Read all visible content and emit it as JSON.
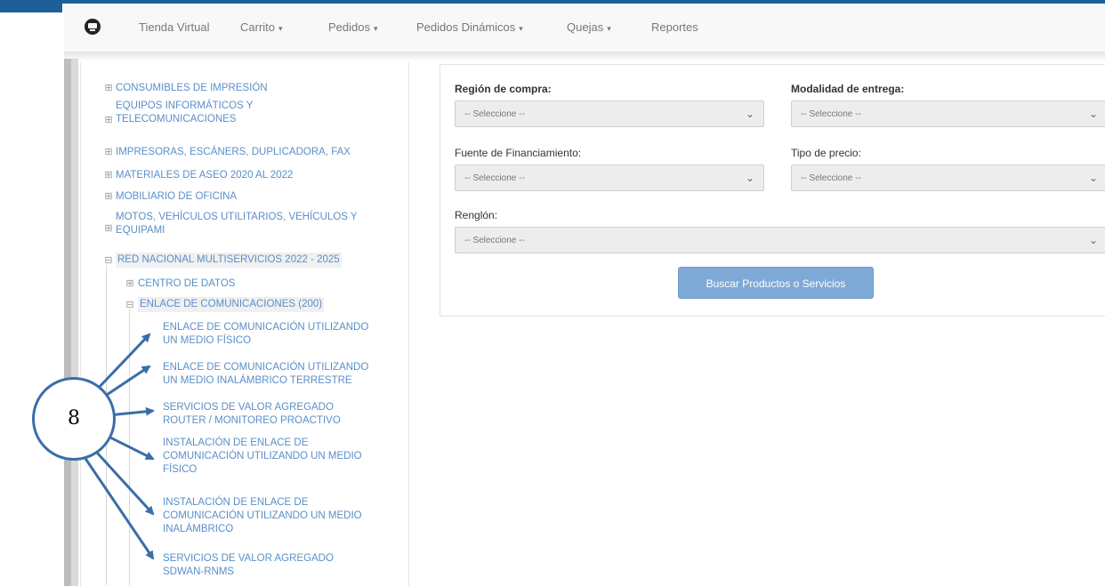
{
  "nav": {
    "items": [
      {
        "label": "Tienda Virtual",
        "caret": false
      },
      {
        "label": "Carrito",
        "caret": true
      },
      {
        "label": "Pedidos",
        "caret": true
      },
      {
        "label": "Pedidos Dinámicos",
        "caret": true
      },
      {
        "label": "Quejas",
        "caret": true
      },
      {
        "label": "Reportes",
        "caret": false
      }
    ],
    "caret_glyph": "▾"
  },
  "tree": {
    "items": [
      {
        "label": "CONSUMIBLES DE IMPRESIÓN"
      },
      {
        "label_lines": [
          "EQUIPOS INFORMÁTICOS Y",
          "TELECOMUNICACIONES"
        ]
      },
      {
        "label": "IMPRESORAS, ESCÁNERS, DUPLICADORA, FAX"
      },
      {
        "label": "MATERIALES DE ASEO 2020 AL 2022"
      },
      {
        "label": "MOBILIARIO DE OFICINA"
      },
      {
        "label_lines": [
          "MOTOS, VEHÍCULOS UTILITARIOS, VEHÍCULOS Y",
          "EQUIPAMI"
        ]
      },
      {
        "label": "RED NACIONAL MULTISERVICIOS 2022 - 2025"
      },
      {
        "label": "CENTRO DE DATOS"
      },
      {
        "label": "ENLACE DE COMUNICACIONES (200)"
      }
    ],
    "leaves": [
      {
        "lines": [
          "ENLACE DE COMUNICACIÓN UTILIZANDO",
          "UN MEDIO FÍSICO"
        ]
      },
      {
        "lines": [
          "ENLACE DE COMUNICACIÓN UTILIZANDO",
          "UN MEDIO INALÁMBRICO TERRESTRE"
        ]
      },
      {
        "lines": [
          "SERVICIOS DE VALOR AGREGADO",
          "ROUTER / MONITOREO PROACTIVO"
        ]
      },
      {
        "lines": [
          "INSTALACIÓN DE ENLACE DE",
          "COMUNICACIÓN UTILIZANDO UN MEDIO",
          "FÍSICO"
        ]
      },
      {
        "lines": [
          "INSTALACIÓN DE ENLACE DE",
          "COMUNICACIÓN UTILIZANDO UN MEDIO",
          "INALÁMBRICO"
        ]
      },
      {
        "lines": [
          "SERVICIOS DE VALOR AGREGADO",
          "SDWAN-RNMS"
        ]
      }
    ],
    "expand_glyph": "⊞",
    "collapse_glyph": "⊟"
  },
  "form": {
    "region_label": "Región de compra:",
    "modalidad_label": "Modalidad de entrega:",
    "fuente_label": "Fuente de Financiamiento:",
    "tipo_label": "Tipo de precio:",
    "renglon_label": "Renglón:",
    "select_placeholder": "-- Seleccione --",
    "chevron": "⌄",
    "search_button": "Buscar Productos o Servicios"
  },
  "annotation": {
    "callout_number": "8",
    "arrow_color": "#3a6ea8"
  }
}
